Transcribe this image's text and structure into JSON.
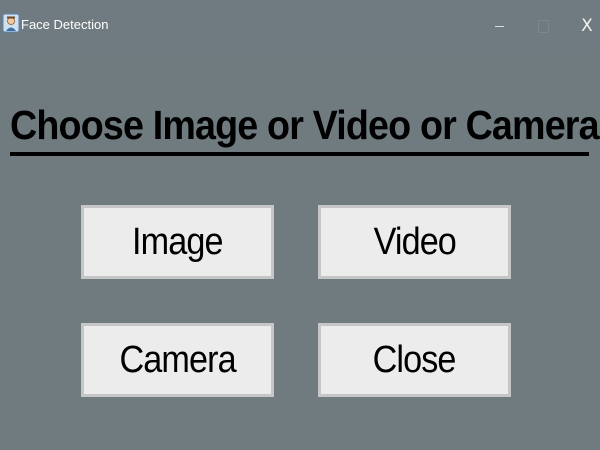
{
  "window": {
    "title": "Face Detection",
    "controls": {
      "minimize": "–",
      "maximize": "",
      "close": "X"
    },
    "icon": "face-detection-app-icon"
  },
  "main": {
    "heading": "Choose Image or Video or Camera",
    "buttons": {
      "image": "Image",
      "video": "Video",
      "camera": "Camera",
      "close": "Close"
    }
  },
  "colors": {
    "background": "#707b80",
    "button_face": "#ececec",
    "button_border": "#c6c6c6",
    "text": "#000000",
    "titlebar_text": "#ffffff"
  }
}
